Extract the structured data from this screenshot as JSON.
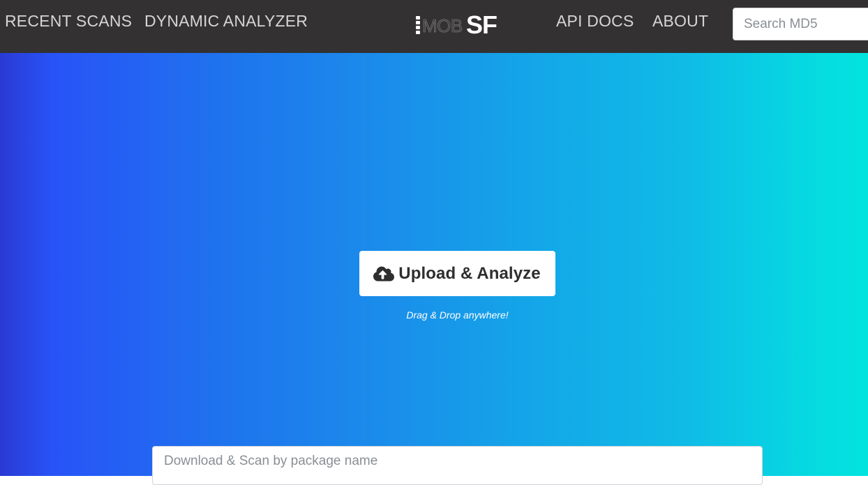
{
  "nav": {
    "recent_scans": "RECENT SCANS",
    "dynamic_analyzer": "DYNAMIC ANALYZER",
    "api_docs": "API DOCS",
    "about": "ABOUT"
  },
  "logo": {
    "mob": "MOB",
    "sf": "SF"
  },
  "search": {
    "placeholder": "Search MD5",
    "value": ""
  },
  "upload": {
    "button_label": "Upload & Analyze",
    "icon": "cloud-upload-icon",
    "hint": "Drag & Drop anywhere!"
  },
  "package_download": {
    "placeholder": "Download & Scan by package name",
    "value": ""
  },
  "colors": {
    "navbar_bg": "#333132",
    "nav_text": "#d6d6d6",
    "gradient_left": "#2853f7",
    "gradient_right": "#02e3de",
    "button_bg": "#ffffff",
    "button_text": "#2e2e2e"
  }
}
